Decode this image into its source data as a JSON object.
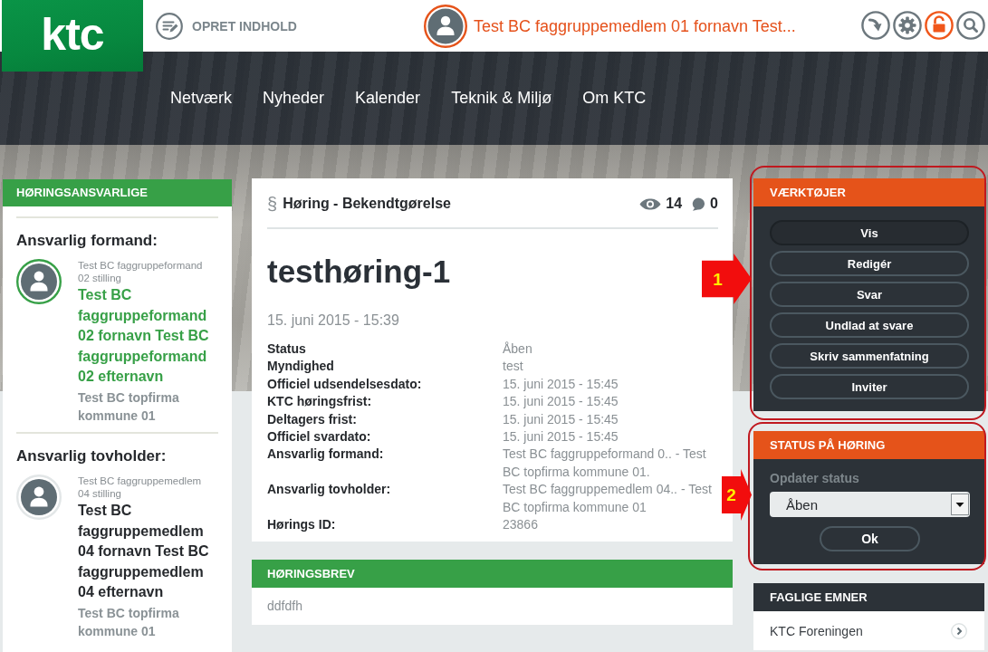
{
  "header": {
    "logo": "ktc",
    "create_button": "OPRET INDHOLD",
    "user_name": "Test BC faggruppemedlem 01 fornavn Test..."
  },
  "nav": {
    "items": [
      "Netværk",
      "Nyheder",
      "Kalender",
      "Teknik & Miljø",
      "Om KTC"
    ]
  },
  "sidebar": {
    "title": "HØRINGSANSVARLIGE",
    "groups": [
      {
        "heading": "Ansvarlig formand:",
        "position": "Test BC faggruppeformand 02 stilling",
        "name": "Test BC faggruppeformand 02 fornavn Test BC faggruppeformand 02 efternavn",
        "organization": "Test BC topfirma kommune 01",
        "highlighted": true
      },
      {
        "heading": "Ansvarlig tovholder:",
        "position": "Test BC faggruppemedlem 04 stilling",
        "name": "Test BC faggruppemedlem 04 fornavn Test BC faggruppemedlem 04 efternavn",
        "organization": "Test BC topfirma kommune 01",
        "highlighted": false
      }
    ]
  },
  "article": {
    "symbol": "§",
    "type": "Høring - Bekendtgørelse",
    "views": "14",
    "comments": "0",
    "title": "testhøring-1",
    "date": "15. juni 2015 - 15:39",
    "details": [
      {
        "label": "Status",
        "value": "Åben"
      },
      {
        "label": "Myndighed",
        "value": "test"
      },
      {
        "label": "Officiel udsendelsesdato:",
        "value": "15. juni 2015 - 15:45"
      },
      {
        "label": "KTC høringsfrist:",
        "value": "15. juni 2015 - 15:45"
      },
      {
        "label": "Deltagers frist:",
        "value": "15. juni 2015 - 15:45"
      },
      {
        "label": "Officiel svardato:",
        "value": "15. juni 2015 - 15:45"
      },
      {
        "label": "Ansvarlig formand:",
        "value": "Test BC faggruppeformand 0.. - Test BC topfirma kommune 01."
      },
      {
        "label": "Ansvarlig tovholder:",
        "value": "Test BC faggruppemedlem 04.. - Test BC topfirma kommune 01"
      },
      {
        "label": "Hørings ID:",
        "value": "23866"
      }
    ]
  },
  "letter": {
    "title": "HØRINGSBREV",
    "body": "ddfdfh"
  },
  "tools": {
    "title": "VÆRKTØJER",
    "buttons": [
      {
        "label": "Vis",
        "selected": true
      },
      {
        "label": "Redigér",
        "selected": false
      },
      {
        "label": "Svar",
        "selected": false
      },
      {
        "label": "Undlad at svare",
        "selected": false
      },
      {
        "label": "Skriv sammenfatning",
        "selected": false
      },
      {
        "label": "Inviter",
        "selected": false
      }
    ]
  },
  "status_panel": {
    "title": "STATUS PÅ HØRING",
    "label": "Opdater status",
    "value": "Åben",
    "button": "Ok"
  },
  "topics": {
    "title": "FAGLIGE EMNER",
    "items": [
      "KTC Foreningen"
    ]
  },
  "annotations": [
    {
      "label": "1"
    },
    {
      "label": "2"
    }
  ]
}
